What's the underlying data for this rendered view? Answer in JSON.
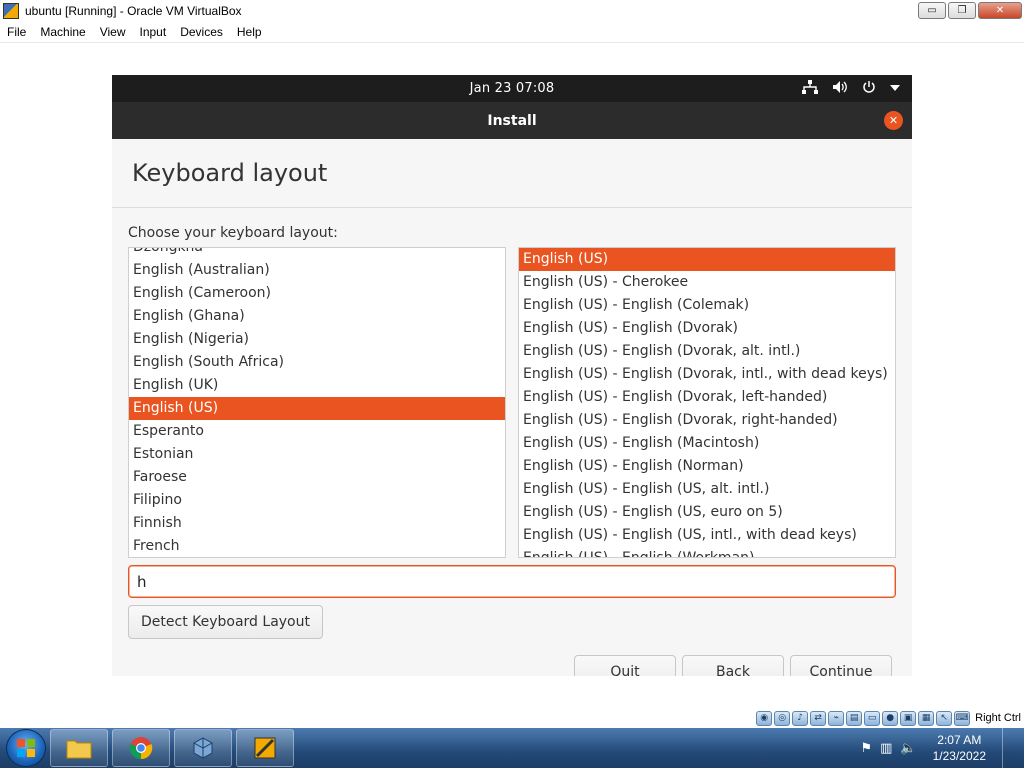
{
  "host_window": {
    "title": "ubuntu [Running] - Oracle VM VirtualBox",
    "menu": [
      "File",
      "Machine",
      "View",
      "Input",
      "Devices",
      "Help"
    ],
    "buttons": {
      "minimize": "▭",
      "restore": "❐",
      "close": "✕"
    }
  },
  "guest_topbar": {
    "clock": "Jan 23  07:08",
    "tray_icons": [
      "network-icon",
      "volume-icon",
      "power-icon",
      "chevron-down-icon"
    ]
  },
  "installer": {
    "window_title": "Install",
    "close_glyph": "✕",
    "page_title": "Keyboard layout",
    "choose_label": "Choose your keyboard layout:",
    "layouts": [
      "Dzongkha",
      "English (Australian)",
      "English (Cameroon)",
      "English (Ghana)",
      "English (Nigeria)",
      "English (South Africa)",
      "English (UK)",
      "English (US)",
      "Esperanto",
      "Estonian",
      "Faroese",
      "Filipino",
      "Finnish",
      "French"
    ],
    "selected_layout": "English (US)",
    "variants": [
      "English (US)",
      "English (US) - Cherokee",
      "English (US) - English (Colemak)",
      "English (US) - English (Dvorak)",
      "English (US) - English (Dvorak, alt. intl.)",
      "English (US) - English (Dvorak, intl., with dead keys)",
      "English (US) - English (Dvorak, left-handed)",
      "English (US) - English (Dvorak, right-handed)",
      "English (US) - English (Macintosh)",
      "English (US) - English (Norman)",
      "English (US) - English (US, alt. intl.)",
      "English (US) - English (US, euro on 5)",
      "English (US) - English (US, intl., with dead keys)",
      "English (US) - English (Workman)"
    ],
    "selected_variant": "English (US)",
    "test_input_value": "h",
    "detect_button": "Detect Keyboard Layout",
    "quit_button": "Quit",
    "back_button": "Back",
    "continue_button": "Continue"
  },
  "statusbar": {
    "host_key": "Right Ctrl"
  },
  "taskbar": {
    "clock_time": "2:07 AM",
    "clock_date": "1/23/2022"
  },
  "colors": {
    "accent": "#e95420",
    "topbar": "#1d1d1d",
    "header": "#2c2c2c"
  }
}
